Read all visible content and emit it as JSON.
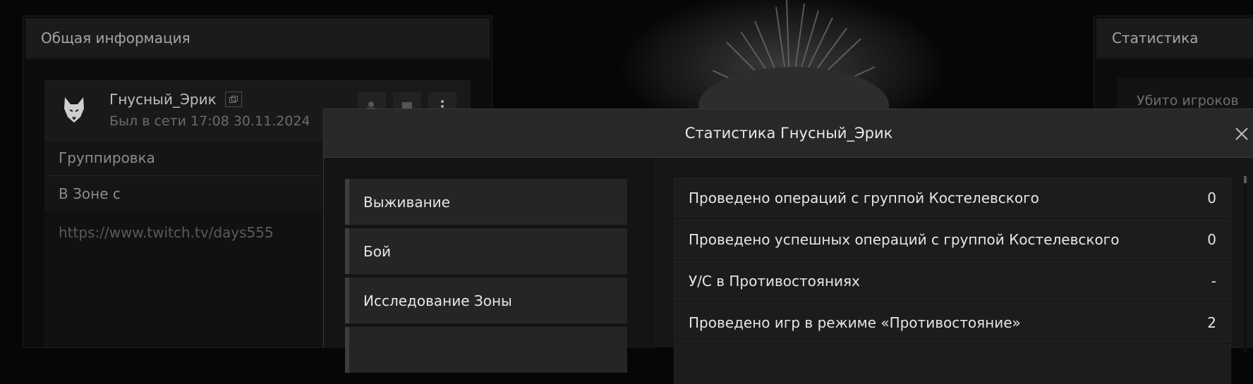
{
  "left_panel": {
    "title": "Общая информация",
    "profile": {
      "username": "Гнусный_Эрик",
      "last_seen": "Был в сети 17:08 30.11.2024"
    },
    "rows": [
      {
        "label": "Группировка"
      },
      {
        "label": "В Зоне с"
      }
    ],
    "link": "https://www.twitch.tv/days555"
  },
  "right_panel": {
    "title": "Статистика",
    "stat_label": "Убито игроков"
  },
  "modal": {
    "title": "Статистика Гнусный_Эрик",
    "categories": [
      "Выживание",
      "Бой",
      "Исследование Зоны",
      ""
    ],
    "stats": [
      {
        "label": "Проведено операций с группой Костелевского",
        "value": "0"
      },
      {
        "label": "Проведено успешных операций с группой Костелевского",
        "value": "0"
      },
      {
        "label": "У/С в Противостояниях",
        "value": "-"
      },
      {
        "label": "Проведено игр в режиме «Противостояние»",
        "value": "2"
      },
      {
        "label": "",
        "value": ""
      }
    ]
  },
  "icons": {
    "avatar": "wolf-head-icon",
    "copy": "copy-icon",
    "close": "close-icon",
    "more": "more-vertical-icon"
  }
}
